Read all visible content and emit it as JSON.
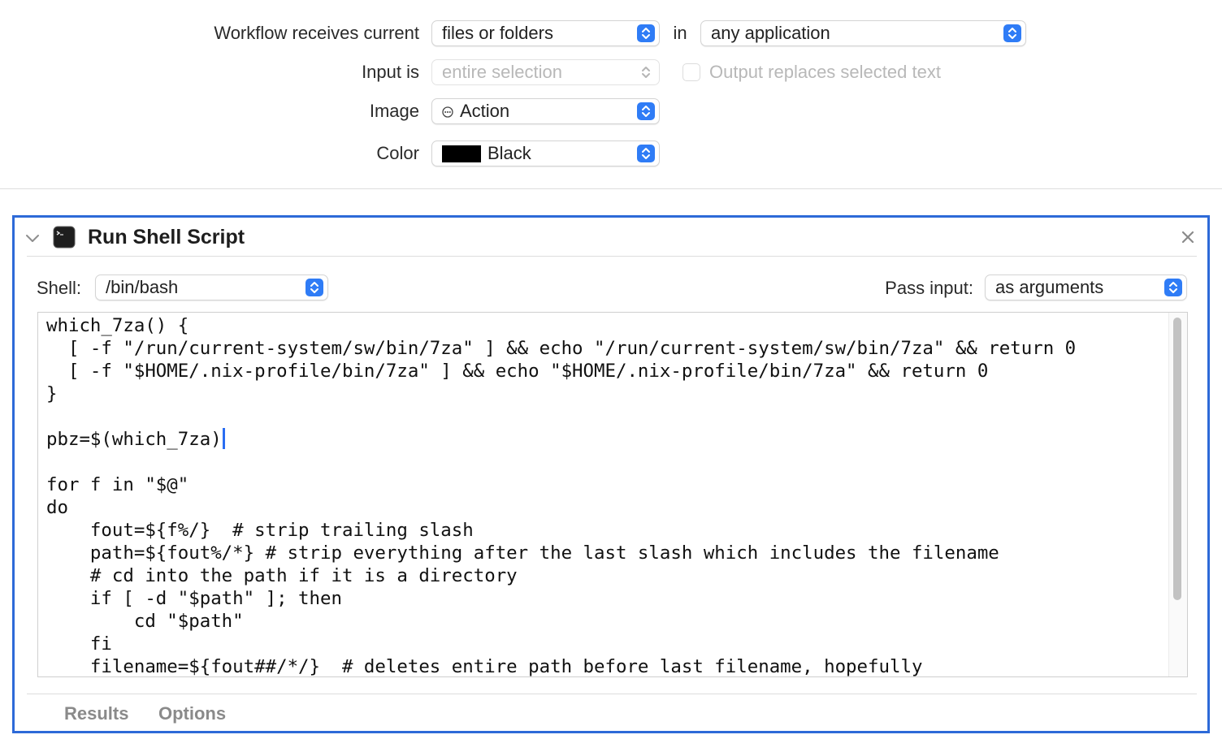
{
  "workflow": {
    "receives_label": "Workflow receives current",
    "receives_value": "files or folders",
    "in_label": "in",
    "application_value": "any application",
    "input_label": "Input is",
    "input_value": "entire selection",
    "output_replaces_label": "Output replaces selected text",
    "output_replaces_checked": false,
    "image_label": "Image",
    "image_value": "Action",
    "image_icon": "action-ellipsis-icon",
    "color_label": "Color",
    "color_value": "Black",
    "color_swatch": "#000000"
  },
  "action": {
    "title": "Run Shell Script",
    "icon": "terminal-icon",
    "accent": "#2d6ad8",
    "shell_label": "Shell:",
    "shell_value": "/bin/bash",
    "pass_input_label": "Pass input:",
    "pass_input_value": "as arguments",
    "script_lines": [
      "which_7za() {",
      "  [ -f \"/run/current-system/sw/bin/7za\" ] && echo \"/run/current-system/sw/bin/7za\" && return 0",
      "  [ -f \"$HOME/.nix-profile/bin/7za\" ] && echo \"$HOME/.nix-profile/bin/7za\" && return 0",
      "}",
      "",
      "pbz=$(which_7za)",
      "",
      "for f in \"$@\"",
      "do",
      "    fout=${f%/}  # strip trailing slash",
      "    path=${fout%/*} # strip everything after the last slash which includes the filename",
      "    # cd into the path if it is a directory",
      "    if [ -d \"$path\" ]; then",
      "        cd \"$path\"",
      "    fi",
      "    filename=${fout##/*/}  # deletes entire path before last filename, hopefully"
    ],
    "caret_line": 5,
    "tabs": {
      "results": "Results",
      "options": "Options"
    }
  }
}
